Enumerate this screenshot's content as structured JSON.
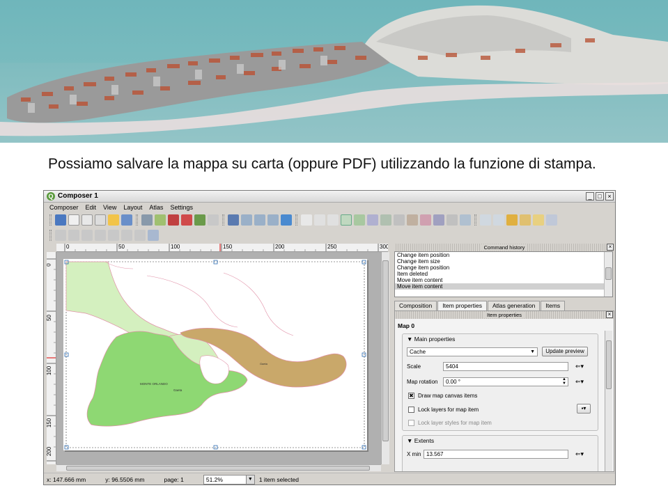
{
  "caption": "Possiamo salvare la mappa su carta (oppure PDF) utilizzando la funzione di stampa.",
  "window": {
    "title": "Composer 1",
    "app_icon": "qgis-icon",
    "controls": [
      "_",
      "□",
      "×"
    ]
  },
  "menu": [
    "Composer",
    "Edit",
    "View",
    "Layout",
    "Atlas",
    "Settings"
  ],
  "ruler": {
    "top_labels": [
      "0",
      "50",
      "100",
      "150",
      "200",
      "250",
      "300"
    ],
    "left_labels": [
      "0",
      "50",
      "100",
      "150",
      "200"
    ]
  },
  "map": {
    "place_label": "MONTE ORLANDO",
    "city_label": "Gaeta",
    "small_label": "Gaeta",
    "colors": {
      "water": "#ffffff",
      "light_green": "#d4f0bf",
      "green": "#8ed873",
      "tan": "#c9a86a",
      "boundary": "#e08fa6"
    }
  },
  "status": {
    "x": "x: 147.666 mm",
    "y": "y: 96.5506 mm",
    "page": "page: 1",
    "zoom": "51.2%",
    "selection": "1 item selected"
  },
  "command_history": {
    "title": "Command history",
    "items": [
      "Change item position",
      "Change item size",
      "Change item position",
      "Item deleted",
      "Move item content",
      "Move item content"
    ],
    "selected_index": 5
  },
  "tabs": [
    "Composition",
    "Item properties",
    "Atlas generation",
    "Items"
  ],
  "active_tab": "Item properties",
  "item_properties": {
    "title": "Item properties",
    "map_name": "Map 0",
    "main_group": "Main properties",
    "cache_value": "Cache",
    "update_preview": "Update preview",
    "scale_label": "Scale",
    "scale_value": "5404",
    "rotation_label": "Map rotation",
    "rotation_value": "0.00 °",
    "draw_canvas_items": "Draw map canvas items",
    "draw_canvas_checked": true,
    "lock_layers": "Lock layers for map item",
    "lock_styles": "Lock layer styles for map item",
    "extents_group": "Extents",
    "xmin_label": "X min",
    "xmin_value": "13.567"
  }
}
